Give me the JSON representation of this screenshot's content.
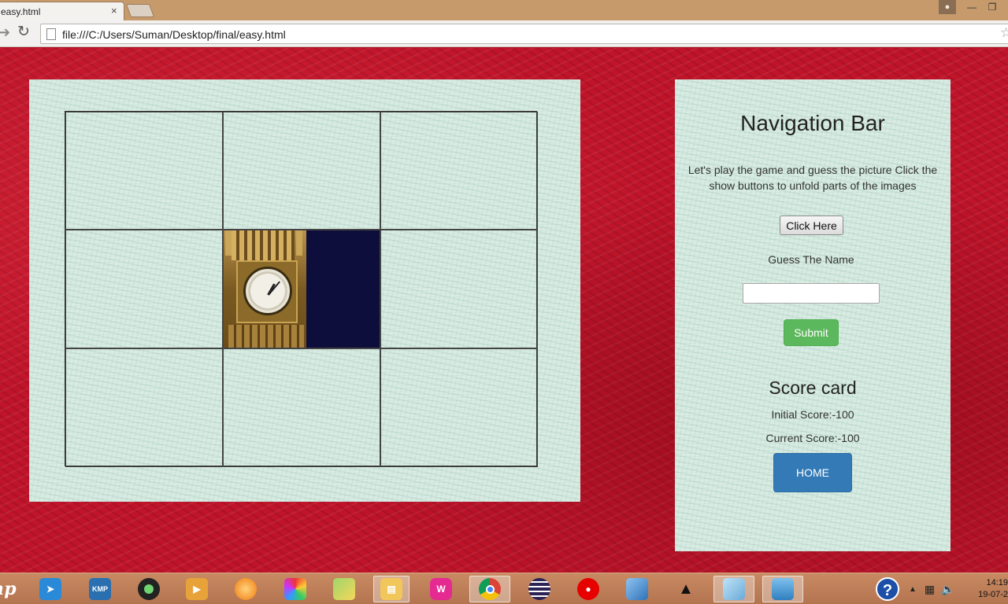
{
  "browser": {
    "tab_title": "easy.html",
    "tab_close": "×",
    "url": "file:///C:/Users/Suman/Desktop/final/easy.html",
    "forward_glyph": "➔",
    "reload_glyph": "↻",
    "star_glyph": "☆",
    "window_min": "—",
    "window_max": "❐"
  },
  "game": {
    "grid_rows": 3,
    "grid_cols": 3,
    "revealed_cells": [
      "row2-col2"
    ],
    "revealed_image": "big-ben-clock-tower-icon"
  },
  "nav": {
    "title": "Navigation Bar",
    "description": "Let's play the game and guess the picture Click the show buttons to unfold parts of the images",
    "click_button": "Click Here",
    "guess_label": "Guess The Name",
    "guess_value": "",
    "submit_button": "Submit",
    "score_title": "Score card",
    "initial_score": "Initial Score:-100",
    "current_score": "Current Score:-100",
    "home_button": "HOME"
  },
  "taskbar": {
    "start_logo": "hp",
    "apps": [
      {
        "name": "rocket-app-icon",
        "active": false
      },
      {
        "name": "kmp-player-icon",
        "active": false
      },
      {
        "name": "webcam-icon",
        "active": false
      },
      {
        "name": "media-player-icon",
        "active": false
      },
      {
        "name": "orange-orb-icon",
        "active": false
      },
      {
        "name": "colorful-grid-app-icon",
        "active": false
      },
      {
        "name": "notes-folders-icon",
        "active": false
      },
      {
        "name": "file-explorer-icon",
        "active": false
      },
      {
        "name": "wamp-server-icon",
        "active": false
      },
      {
        "name": "chrome-icon",
        "active": true
      },
      {
        "name": "eclipse-icon",
        "active": false
      },
      {
        "name": "vodafone-icon",
        "active": false
      },
      {
        "name": "virtualbox-icon",
        "active": false
      },
      {
        "name": "penguin-app-icon",
        "active": false
      },
      {
        "name": "notepad-icon",
        "active": false
      },
      {
        "name": "photos-app-icon",
        "active": false
      }
    ],
    "tray": {
      "help_glyph": "?",
      "clock_time": "14:19",
      "clock_date": "19-07-2"
    }
  },
  "colors": {
    "submit_green": "#5cb85c",
    "home_blue": "#337ab7",
    "background_red": "#c0142a",
    "panel_texture": "#d9ece4"
  }
}
